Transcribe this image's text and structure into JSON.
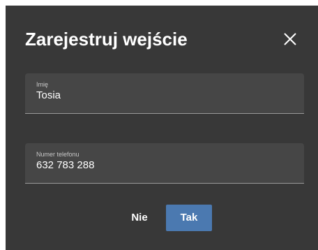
{
  "dialog": {
    "title": "Zarejestruj wejście",
    "close_icon": "close-icon"
  },
  "fields": {
    "name": {
      "label": "Imię",
      "value": "Tosia"
    },
    "phone": {
      "label": "Numer telefonu",
      "value": "632 783 288"
    }
  },
  "actions": {
    "no_label": "Nie",
    "yes_label": "Tak"
  },
  "colors": {
    "dialog_background": "#383838",
    "field_background": "#464646",
    "primary_button": "#4b79b0",
    "text": "#ffffff"
  }
}
